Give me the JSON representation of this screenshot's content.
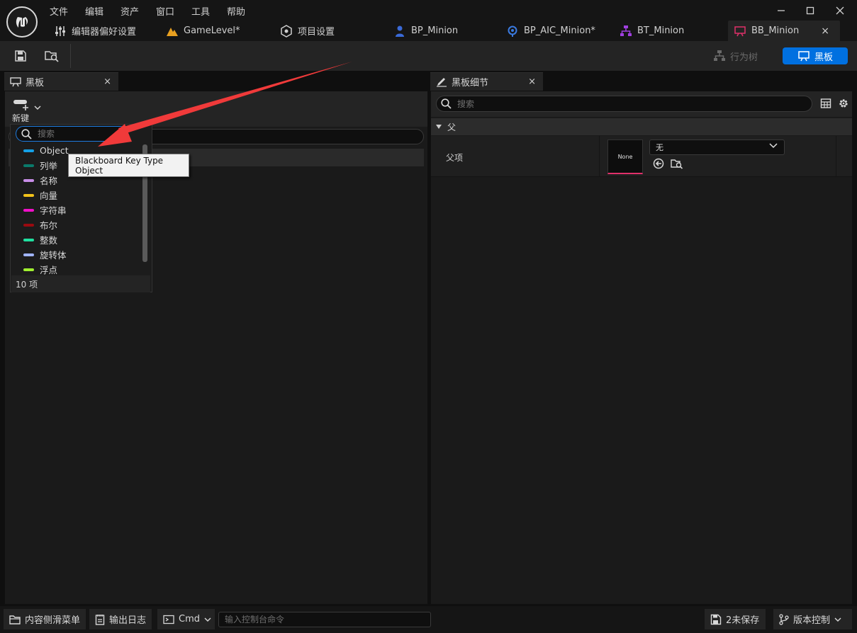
{
  "menu": [
    "文件",
    "编辑",
    "资产",
    "窗口",
    "工具",
    "帮助"
  ],
  "tabs": [
    {
      "label": "编辑器偏好设置",
      "icon": "sliders-icon"
    },
    {
      "label": "GameLevel*",
      "icon": "level-icon"
    },
    {
      "label": "项目设置",
      "icon": "project-settings-icon"
    },
    {
      "label": "BP_Minion",
      "icon": "character-icon"
    },
    {
      "label": "BP_AIC_Minion*",
      "icon": "ai-controller-icon"
    },
    {
      "label": "BT_Minion",
      "icon": "behavior-tree-icon"
    },
    {
      "label": "BB_Minion",
      "icon": "blackboard-icon",
      "close": "×"
    }
  ],
  "toolbar": {
    "behavior_tree_label": "行为树",
    "blackboard_label": "黑板"
  },
  "left_panel": {
    "tab_label": "黑板",
    "tab_close": "×",
    "new_key_label": "新键"
  },
  "dropdown": {
    "search_placeholder": "搜索",
    "items": [
      {
        "label": "Object",
        "color": "#14a0e6"
      },
      {
        "label": "列举",
        "color": "#0a7a6a"
      },
      {
        "label": "名称",
        "color": "#c88ee8"
      },
      {
        "label": "向量",
        "color": "#f2c21a"
      },
      {
        "label": "字符串",
        "color": "#f010c8"
      },
      {
        "label": "布尔",
        "color": "#9a0a10"
      },
      {
        "label": "整数",
        "color": "#20e0a0"
      },
      {
        "label": "旋转体",
        "color": "#a0b4ff"
      },
      {
        "label": "浮点",
        "color": "#a0f030"
      }
    ],
    "count_label": "10 项",
    "tooltip": "Blackboard Key Type Object"
  },
  "right_panel": {
    "tab_label": "黑板细节",
    "tab_close": "×",
    "search_placeholder": "搜索",
    "category": "父",
    "property_name": "父项",
    "thumbnail_text": "None",
    "combo_value": "无"
  },
  "statusbar": {
    "content_drawer": "内容侧滑菜单",
    "output_log": "输出日志",
    "cmd": "Cmd",
    "console_placeholder": "输入控制台命令",
    "unsaved": "2未保存",
    "source_control": "版本控制"
  },
  "colors": {
    "accent": "#0070e0",
    "annotation_arrow": "#f03a3a",
    "asset_underline": "#e0306a"
  }
}
